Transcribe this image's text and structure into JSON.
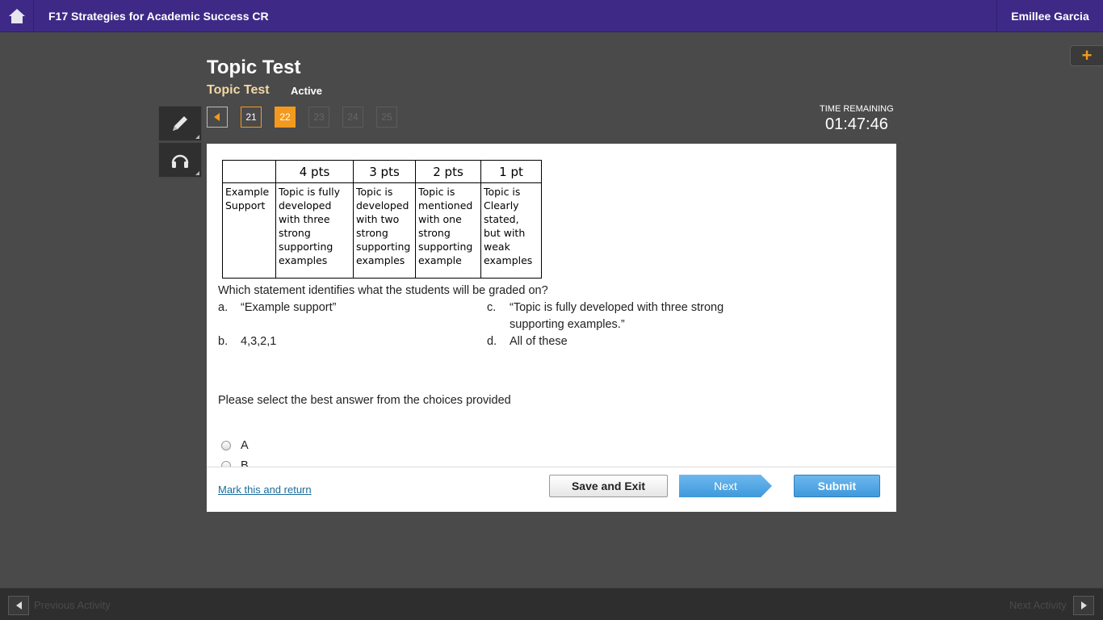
{
  "header": {
    "course_title": "F17 Strategies for Academic Success CR",
    "user_name": "Emillee Garcia"
  },
  "page": {
    "title": "Topic Test",
    "subtitle": "Topic Test",
    "status": "Active"
  },
  "question_nav": {
    "items": [
      "21",
      "22",
      "23",
      "24",
      "25"
    ],
    "current": "22"
  },
  "timer": {
    "label": "TIME REMAINING",
    "value": "01:47:46"
  },
  "rubric": {
    "headers": [
      "",
      "4 pts",
      "3 pts",
      "2 pts",
      "1 pt"
    ],
    "row_label": "Example Support",
    "cells": [
      "Topic is fully developed with three strong supporting examples",
      "Topic is developed with two strong supporting examples",
      "Topic is mentioned with one strong supporting example",
      "Topic is Clearly stated, but with weak examples"
    ]
  },
  "question": {
    "text": "Which statement identifies what the students will be graded on?",
    "choices": [
      {
        "letter": "a.",
        "text": "“Example support”"
      },
      {
        "letter": "b.",
        "text": "4,3,2,1"
      },
      {
        "letter": "c.",
        "text": "“Topic is fully developed with three strong supporting examples.”"
      },
      {
        "letter": "d.",
        "text": "All of these"
      }
    ]
  },
  "answer": {
    "instruction": "Please select the best answer from the choices provided",
    "options": [
      "A",
      "B"
    ]
  },
  "actions": {
    "mark_link": "Mark this and return",
    "save_exit": "Save and Exit",
    "next": "Next",
    "submit": "Submit"
  },
  "footer": {
    "prev_label": "Previous Activity",
    "next_label": "Next Activity"
  },
  "icons": {
    "home": "home-icon",
    "plus": "plus-icon",
    "pencil": "pencil-icon",
    "headphones": "headphones-icon"
  },
  "colors": {
    "topbar": "#3e2a86",
    "accent": "#f39a1e",
    "button_blue": "#4aa3e4"
  }
}
